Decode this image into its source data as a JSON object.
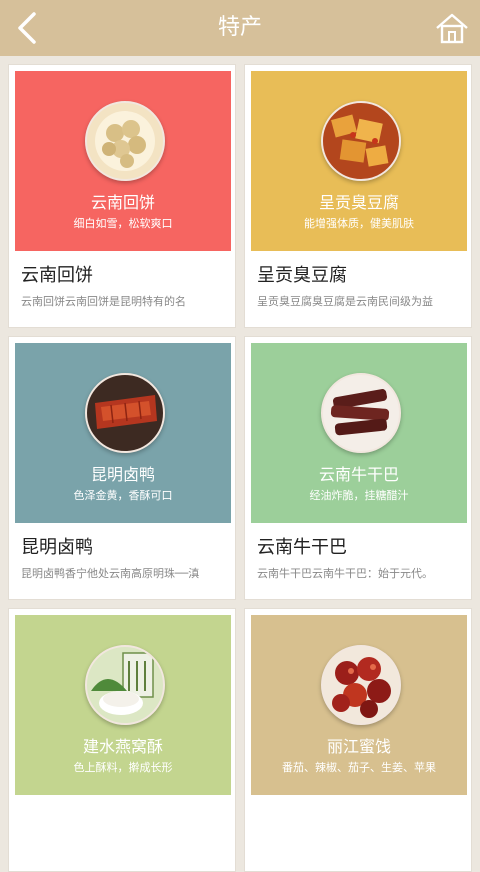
{
  "header": {
    "title": "特产",
    "back_icon": "chevron-left-icon",
    "home_icon": "home-icon"
  },
  "colors": {
    "topbar": "#d6c09a",
    "red": "#f66561",
    "yellow": "#e8bd57",
    "slate": "#7aa3aa",
    "green": "#9ccf9a",
    "lime": "#c3d58f",
    "tan": "#d7c08f"
  },
  "items": [
    {
      "banner_name": "云南回饼",
      "banner_desc": "细白如雪，松软爽口",
      "title": "云南回饼",
      "desc": "云南回饼云南回饼是昆明特有的名"
    },
    {
      "banner_name": "呈贡臭豆腐",
      "banner_desc": "能增强体质，健美肌肤",
      "title": "呈贡臭豆腐",
      "desc": "呈贡臭豆腐臭豆腐是云南民间级为益"
    },
    {
      "banner_name": "昆明卤鸭",
      "banner_desc": "色泽金黄，香酥可口",
      "title": "昆明卤鸭",
      "desc": "昆明卤鸭香宁他处云南高原明珠──滇"
    },
    {
      "banner_name": "云南牛干巴",
      "banner_desc": "经油炸脆，挂糖醋汁",
      "title": "云南牛干巴",
      "desc": "云南牛干巴云南牛干巴：始于元代。"
    },
    {
      "banner_name": "建水燕窝酥",
      "banner_desc": "色上酥料，擀成长形",
      "title": "",
      "desc": ""
    },
    {
      "banner_name": "丽江蜜饯",
      "banner_desc": "番茄、辣椒、茄子、生姜、苹果",
      "title": "",
      "desc": ""
    }
  ]
}
